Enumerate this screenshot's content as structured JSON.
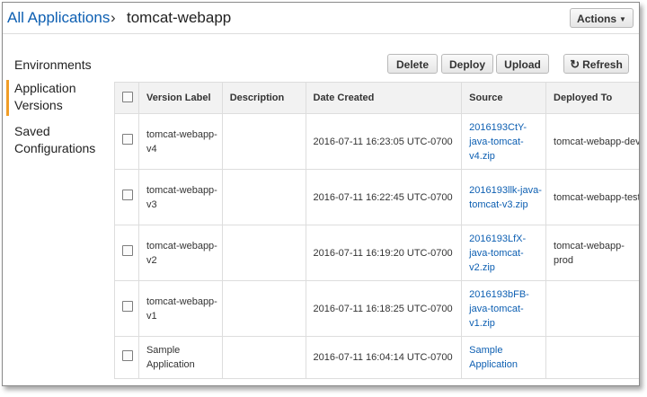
{
  "header": {
    "breadcrumb_root": "All Applications",
    "separator": "›",
    "current": "tomcat-webapp",
    "actions_label": "Actions"
  },
  "sidebar": {
    "items": [
      {
        "label": "Environments"
      },
      {
        "label": "Application Versions",
        "active": true
      },
      {
        "label": "Saved Configurations"
      }
    ]
  },
  "toolbar": {
    "delete_label": "Delete",
    "deploy_label": "Deploy",
    "upload_label": "Upload",
    "refresh_label": "Refresh"
  },
  "table": {
    "columns": [
      "Version Label",
      "Description",
      "Date Created",
      "Source",
      "Deployed To"
    ],
    "rows": [
      {
        "label": "tomcat-webapp-v4",
        "description": "",
        "date": "2016-07-11 16:23:05 UTC-0700",
        "source": "2016193CtY-java-tomcat-v4.zip",
        "deployed": "tomcat-webapp-dev"
      },
      {
        "label": "tomcat-webapp-v3",
        "description": "",
        "date": "2016-07-11 16:22:45 UTC-0700",
        "source": "2016193llk-java-tomcat-v3.zip",
        "deployed": "tomcat-webapp-test"
      },
      {
        "label": "tomcat-webapp-v2",
        "description": "",
        "date": "2016-07-11 16:19:20 UTC-0700",
        "source": "2016193LfX-java-tomcat-v2.zip",
        "deployed": "tomcat-webapp-prod"
      },
      {
        "label": "tomcat-webapp-v1",
        "description": "",
        "date": "2016-07-11 16:18:25 UTC-0700",
        "source": "2016193bFB-java-tomcat-v1.zip",
        "deployed": ""
      },
      {
        "label": "Sample Application",
        "description": "",
        "date": "2016-07-11 16:04:14 UTC-0700",
        "source": "Sample Application",
        "deployed": ""
      }
    ]
  },
  "colors": {
    "link": "#0d5fb2",
    "active_marker": "#f19d26",
    "header_bg": "#f2f2f2"
  },
  "icons": [
    "caret-down-icon",
    "refresh-icon",
    "checkbox-icon"
  ]
}
